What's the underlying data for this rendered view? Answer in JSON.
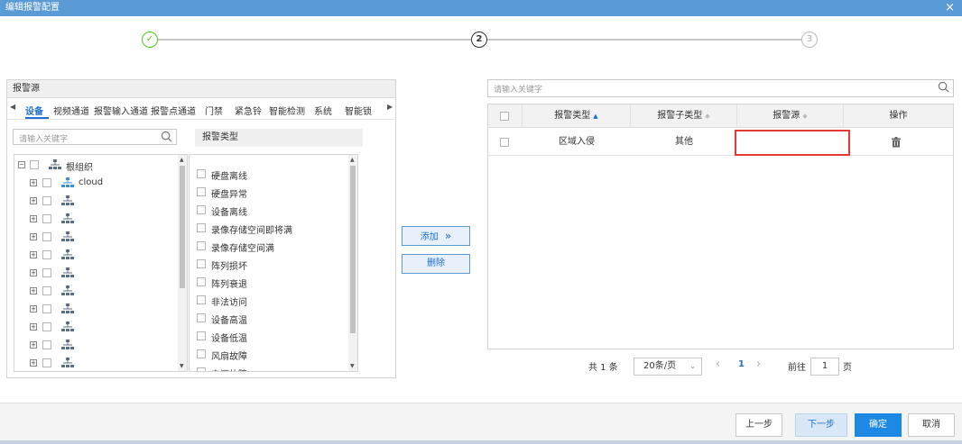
{
  "window": {
    "title": "编辑报警配置",
    "close_glyph": "×"
  },
  "steps": [
    {
      "label": "✓",
      "state": "done"
    },
    {
      "label": "2",
      "state": "active"
    },
    {
      "label": "3",
      "state": "pending"
    }
  ],
  "left": {
    "header": "报警源",
    "tabs": [
      "设备",
      "视频通道",
      "报警输入通道",
      "报警点通道",
      "门禁",
      "紧急铃",
      "智能检测",
      "系统",
      "智能锁"
    ],
    "active_tab": "设备",
    "tree_search_placeholder": "请输入关键字",
    "tree": {
      "root_label": "根组织",
      "cloud_label": "cloud",
      "unnamed_group_count": 10
    },
    "type_header": "报警类型",
    "types": [
      "硬盘离线",
      "硬盘异常",
      "设备离线",
      "录像存储空间即将满",
      "录像存储空间满",
      "阵列损坏",
      "阵列衰退",
      "非法访问",
      "设备高温",
      "设备低温",
      "风扇故障",
      "电源故障"
    ]
  },
  "middle": {
    "add_label": "添加",
    "add_icon": "»",
    "delete_label": "删除"
  },
  "right": {
    "search_placeholder": "请输入关键字",
    "columns": [
      "报警类型",
      "报警子类型",
      "报警源",
      "操作"
    ],
    "rows": [
      {
        "type": "区域入侵",
        "subtype": "其他",
        "source": ""
      }
    ]
  },
  "pagination": {
    "total": "共 1 条",
    "page_size": "20条/页",
    "prev": "‹",
    "current": "1",
    "next": "›",
    "goto_prefix": "前往",
    "goto_value": "1",
    "goto_suffix": "页"
  },
  "footer": {
    "prev": "上一步",
    "next": "下一步",
    "ok": "确定",
    "cancel": "取消"
  },
  "colors": {
    "titlebar": "#5b9bd5",
    "accent": "#1e88e5",
    "highlight_border": "#e53935",
    "done": "#52c41a"
  }
}
